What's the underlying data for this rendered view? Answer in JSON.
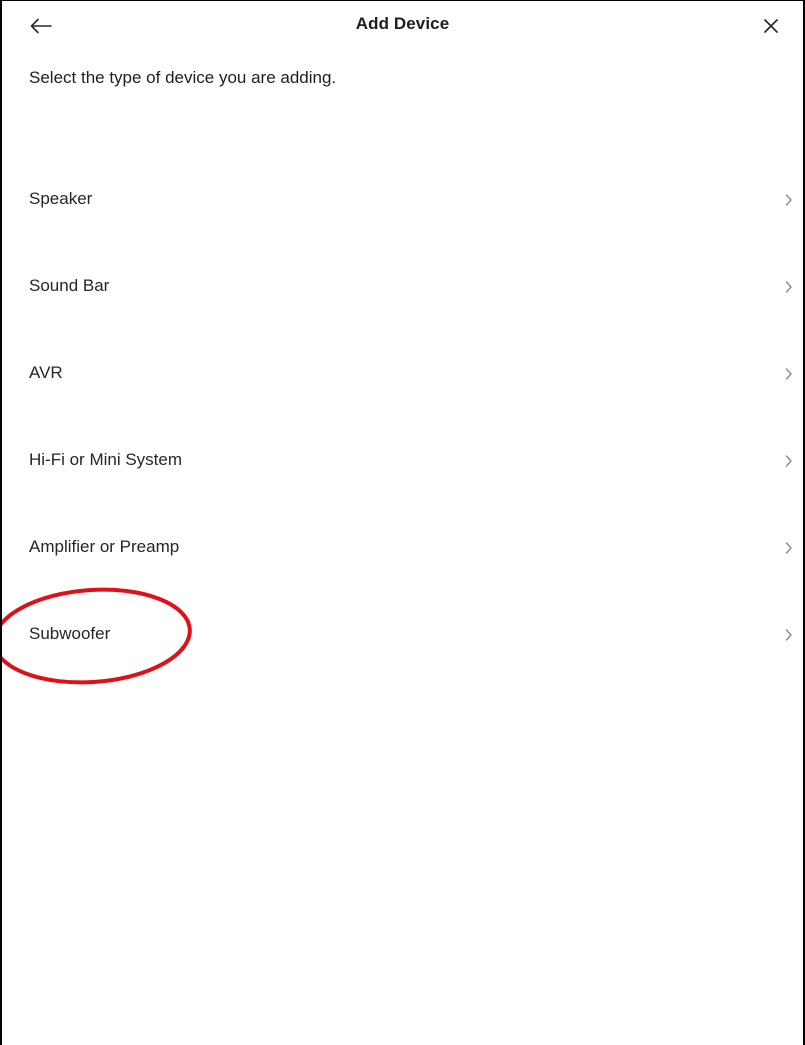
{
  "header": {
    "title": "Add Device",
    "back_icon": "arrow-left-icon",
    "close_icon": "close-icon"
  },
  "subtitle": "Select the type of device you are adding.",
  "device_types": [
    {
      "label": "Speaker"
    },
    {
      "label": "Sound Bar"
    },
    {
      "label": "AVR"
    },
    {
      "label": "Hi-Fi or Mini System"
    },
    {
      "label": "Amplifier or Preamp"
    },
    {
      "label": "Subwoofer"
    }
  ],
  "colors": {
    "highlight": "#e0101a",
    "text": "#1f1f1f",
    "chevron": "#8a8a8a"
  }
}
